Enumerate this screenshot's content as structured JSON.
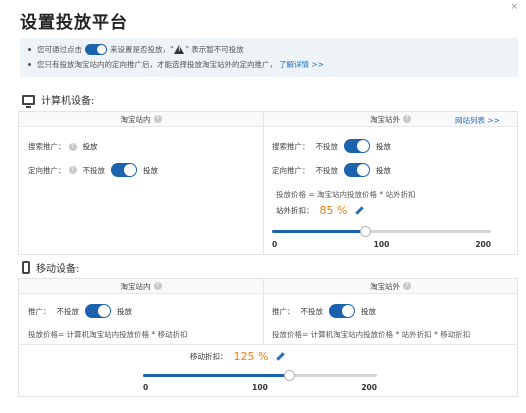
{
  "page": {
    "title": "设置投放平台",
    "close": "×"
  },
  "notice": {
    "line1_a": "您可通过点击",
    "line1_b": "来设置是否投放，\"",
    "line1_c": "\" 表示暂不可投放",
    "line2": "您只有投放淘宝站内的定向推广后，才能选择投放淘宝站外的定向推广，",
    "line2_link": "了解详情 >>"
  },
  "computer": {
    "section_label": "计算机设备:",
    "inner": {
      "header": "淘宝站内",
      "search_label": "搜索推广：",
      "search_value": "投放",
      "target_label": "定向推广：",
      "off_label": "不投放",
      "on_label": "投放"
    },
    "outer": {
      "header": "淘宝站外",
      "site_list_link": "网站列表 >>",
      "search_label": "搜索推广：",
      "target_label": "定向推广：",
      "off_label": "不投放",
      "on_label": "投放",
      "formula": "投放价格 = 淘宝站内投放价格 * 站外折扣",
      "discount_label": "站外折扣：",
      "discount_value": "85 %",
      "slider": {
        "value": 85,
        "min": 0,
        "max": 200,
        "ticks": [
          "0",
          "100",
          "200"
        ]
      }
    }
  },
  "mobile": {
    "section_label": "移动设备:",
    "inner": {
      "header": "淘宝站内",
      "promo_label": "推广：",
      "off_label": "不投放",
      "on_label": "投放",
      "formula": "投放价格= 计算机淘宝站内投放价格 * 移动折扣"
    },
    "outer": {
      "header": "淘宝站外",
      "promo_label": "推广：",
      "off_label": "不投放",
      "on_label": "投放",
      "formula": "投放价格= 计算机淘宝站内投放价格 * 站外折扣 * 移动折扣"
    },
    "discount_label": "移动折扣：",
    "discount_value": "125 %",
    "slider": {
      "value": 125,
      "min": 0,
      "max": 200,
      "ticks": [
        "0",
        "100",
        "200"
      ]
    }
  },
  "colors": {
    "accent": "#1c63ad",
    "orange": "#ee7f16",
    "link": "#1e6ec5"
  },
  "icons": {
    "help": "?",
    "warning": "warning-icon",
    "edit": "pencil-icon",
    "monitor": "monitor-icon",
    "phone": "phone-icon"
  }
}
